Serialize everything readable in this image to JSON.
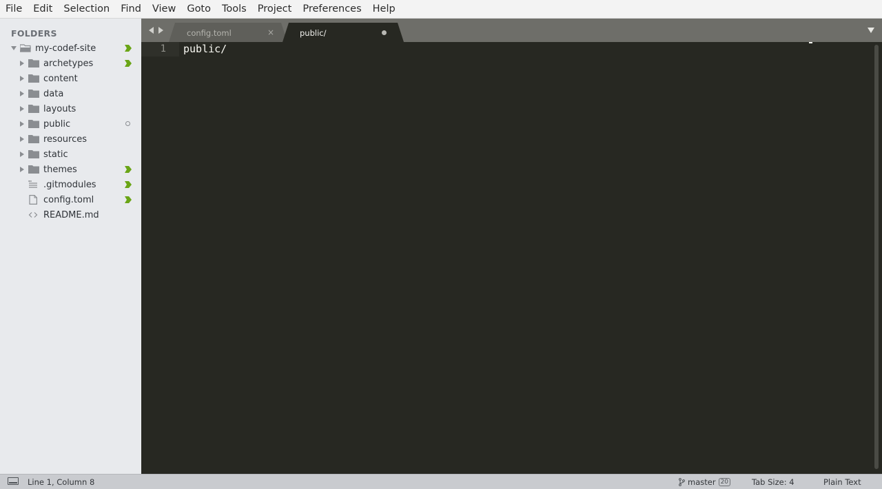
{
  "menu": [
    "File",
    "Edit",
    "Selection",
    "Find",
    "View",
    "Goto",
    "Tools",
    "Project",
    "Preferences",
    "Help"
  ],
  "sidebar": {
    "title": "FOLDERS",
    "root": {
      "label": "my-codef-site",
      "status": "modified"
    },
    "items": [
      {
        "label": "archetypes",
        "type": "folder",
        "status": "modified"
      },
      {
        "label": "content",
        "type": "folder",
        "status": ""
      },
      {
        "label": "data",
        "type": "folder",
        "status": ""
      },
      {
        "label": "layouts",
        "type": "folder",
        "status": ""
      },
      {
        "label": "public",
        "type": "folder",
        "status": "untracked"
      },
      {
        "label": "resources",
        "type": "folder",
        "status": ""
      },
      {
        "label": "static",
        "type": "folder",
        "status": ""
      },
      {
        "label": "themes",
        "type": "folder",
        "status": "modified"
      },
      {
        "label": ".gitmodules",
        "type": "lines-file",
        "status": "modified"
      },
      {
        "label": "config.toml",
        "type": "file",
        "status": "modified"
      },
      {
        "label": "README.md",
        "type": "code-file",
        "status": ""
      }
    ]
  },
  "tabs": [
    {
      "label": "config.toml",
      "active": false,
      "close": "×"
    },
    {
      "label": "public/",
      "active": true,
      "dirty": true
    }
  ],
  "editor": {
    "line_number": "1",
    "content": "public/"
  },
  "status": {
    "position": "Line 1, Column 8",
    "branch": "master",
    "branch_count": "20",
    "tab_size": "Tab Size: 4",
    "syntax": "Plain Text"
  },
  "colors": {
    "vcs_modified": "#6aa516",
    "editor_bg": "#272822",
    "tabbar_bg": "#6e6e69"
  }
}
